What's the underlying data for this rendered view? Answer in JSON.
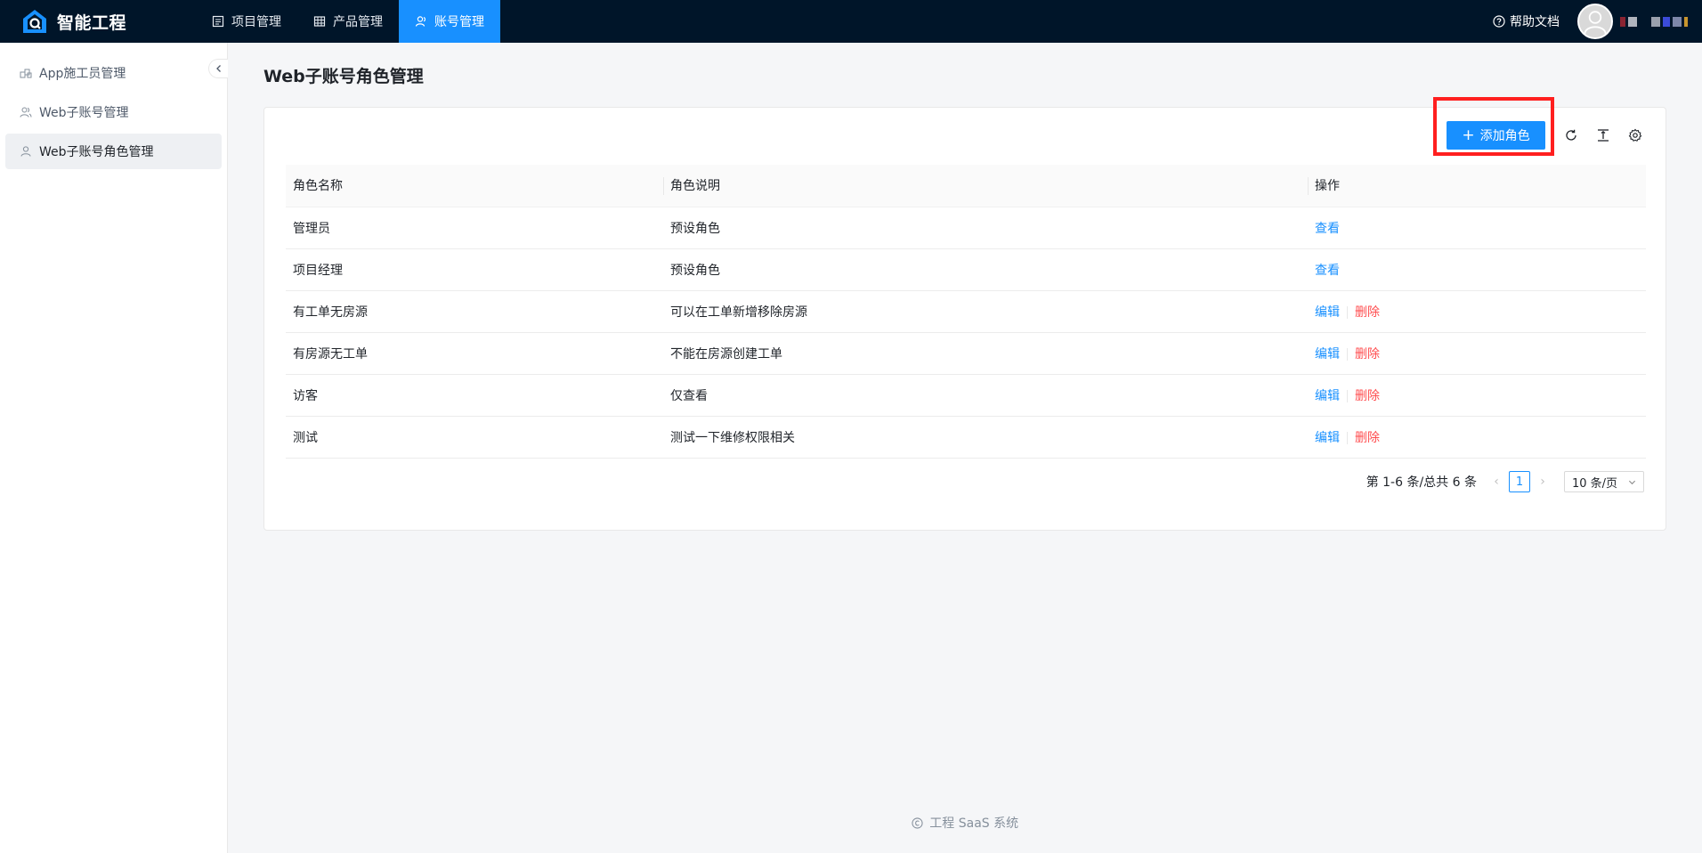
{
  "header": {
    "brand": "智能工程",
    "nav": [
      {
        "label": "项目管理",
        "icon": "list-icon",
        "active": false
      },
      {
        "label": "产品管理",
        "icon": "grid-icon",
        "active": false
      },
      {
        "label": "账号管理",
        "icon": "user-icon",
        "active": true
      }
    ],
    "help_label": "帮助文档"
  },
  "sidebar": {
    "items": [
      {
        "label": "App施工员管理",
        "icon": "team-icon"
      },
      {
        "label": "Web子账号管理",
        "icon": "users-icon"
      },
      {
        "label": "Web子账号角色管理",
        "icon": "user-icon",
        "active": true
      }
    ]
  },
  "page": {
    "title": "Web子账号角色管理",
    "add_button": "添加角色"
  },
  "table": {
    "headers": [
      "角色名称",
      "角色说明",
      "操作"
    ],
    "rows": [
      {
        "name": "管理员",
        "desc": "预设角色",
        "actions": [
          "查看"
        ]
      },
      {
        "name": "项目经理",
        "desc": "预设角色",
        "actions": [
          "查看"
        ]
      },
      {
        "name": "有工单无房源",
        "desc": "可以在工单新增移除房源",
        "actions": [
          "编辑",
          "删除"
        ]
      },
      {
        "name": "有房源无工单",
        "desc": "不能在房源创建工单",
        "actions": [
          "编辑",
          "删除"
        ]
      },
      {
        "name": "访客",
        "desc": "仅查看",
        "actions": [
          "编辑",
          "删除"
        ]
      },
      {
        "name": "测试",
        "desc": "测试一下维修权限相关",
        "actions": [
          "编辑",
          "删除"
        ]
      }
    ]
  },
  "pagination": {
    "summary": "第 1-6 条/总共 6 条",
    "current": "1",
    "page_size": "10 条/页"
  },
  "footer": "工程 SaaS 系统",
  "colors": {
    "header_bg": "#001529",
    "primary": "#1890ff",
    "danger": "#ff4d4f",
    "highlight_box": "#ff1f1f"
  }
}
